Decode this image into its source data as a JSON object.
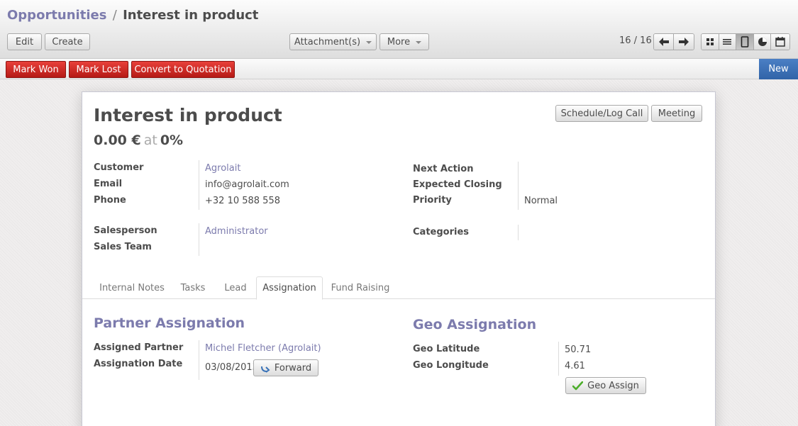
{
  "breadcrumb": {
    "parent": "Opportunities",
    "separator": "/",
    "current": "Interest in product"
  },
  "toolbar": {
    "edit_label": "Edit",
    "create_label": "Create",
    "attachments_label": "Attachment(s)",
    "more_label": "More",
    "pager": "16 / 16"
  },
  "view_switcher": {
    "views": [
      "kanban-view",
      "list-view",
      "form-view",
      "graph-view",
      "calendar-view"
    ],
    "active": "form-view"
  },
  "statusbar": {
    "mark_won_label": "Mark Won",
    "mark_lost_label": "Mark Lost",
    "convert_label": "Convert to Quotation",
    "stage_label": "New"
  },
  "record": {
    "title": "Interest in product",
    "amount": "0.00 €",
    "at": "at",
    "probability": "0%",
    "schedule_call_label": "Schedule/Log Call",
    "meeting_label": "Meeting"
  },
  "fields": {
    "customer_label": "Customer",
    "customer_value": "Agrolait",
    "email_label": "Email",
    "email_value": "info@agrolait.com",
    "phone_label": "Phone",
    "phone_value": "+32 10 588 558",
    "salesperson_label": "Salesperson",
    "salesperson_value": "Administrator",
    "sales_team_label": "Sales Team",
    "sales_team_value": "",
    "next_action_label": "Next Action",
    "expected_closing_label": "Expected Closing",
    "priority_label": "Priority",
    "priority_value": "Normal",
    "categories_label": "Categories"
  },
  "tabs": [
    {
      "label": "Internal Notes"
    },
    {
      "label": "Tasks"
    },
    {
      "label": "Lead"
    },
    {
      "label": "Assignation"
    },
    {
      "label": "Fund Raising"
    }
  ],
  "active_tab": "Assignation",
  "partner_assignation": {
    "title": "Partner Assignation",
    "assigned_partner_label": "Assigned Partner",
    "assigned_partner_value": "Michel Fletcher (Agrolait)",
    "assignation_date_label": "Assignation Date",
    "assignation_date_value": "03/08/2013",
    "forward_label": "Forward"
  },
  "geo_assignation": {
    "title": "Geo Assignation",
    "latitude_label": "Geo Latitude",
    "latitude_value": "50.71",
    "longitude_label": "Geo Longitude",
    "longitude_value": "4.61",
    "geo_assign_label": "Geo Assign"
  },
  "colors": {
    "link": "#7c7bad",
    "danger": "#c42b25",
    "stage": "#3a6fb3",
    "text": "#4c4c4c"
  }
}
